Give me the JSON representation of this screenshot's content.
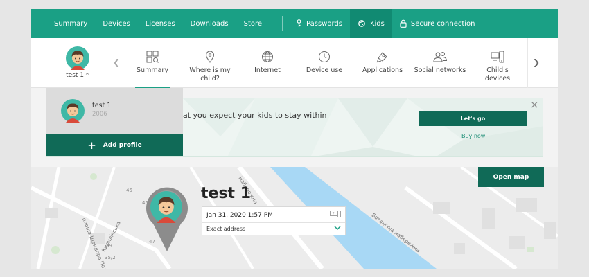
{
  "topnav": {
    "items": [
      "Summary",
      "Devices",
      "Licenses",
      "Downloads",
      "Store"
    ],
    "passwords": "Passwords",
    "kids": "Kids",
    "secure": "Secure connection"
  },
  "profile": {
    "name": "test 1"
  },
  "tabs": [
    {
      "label": "Summary",
      "icon": "summary-icon"
    },
    {
      "label": "Where is my child?",
      "icon": "location-pin-icon"
    },
    {
      "label": "Internet",
      "icon": "globe-icon"
    },
    {
      "label": "Device use",
      "icon": "clock-icon"
    },
    {
      "label": "Applications",
      "icon": "apps-icon"
    },
    {
      "label": "Social networks",
      "icon": "people-icon"
    },
    {
      "label": "Child's devices",
      "icon": "devices-icon"
    }
  ],
  "banner": {
    "text": "at you expect your kids to stay within",
    "go": "Let's go",
    "buy": "Buy now"
  },
  "dropdown": {
    "name": "test 1",
    "year": "2006",
    "add": "Add profile"
  },
  "map": {
    "open_map": "Open map",
    "child_name": "test 1",
    "time": "Jan 31, 2020 1:57 PM",
    "address": "Exact address",
    "labels": [
      "площа Шандора Петефі",
      "Кирилівська",
      "Ботанічна набережна",
      "Набережна",
      "47",
      "45",
      "46",
      "35/2",
      "39"
    ]
  },
  "colors": {
    "accent": "#1aa085",
    "accent_dark": "#106a57"
  }
}
